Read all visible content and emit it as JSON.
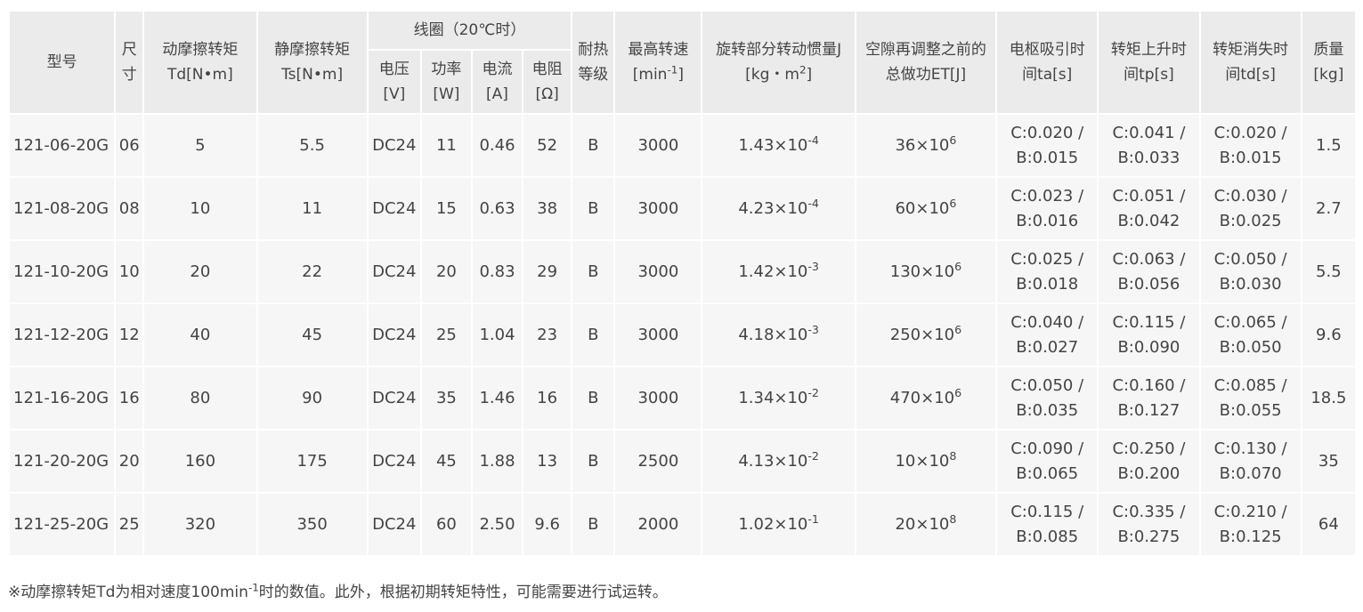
{
  "table": {
    "headers": {
      "model": "型号",
      "size": "尺寸",
      "td": "动摩擦转矩Td[N•m]",
      "ts": "静摩擦转矩Ts[N•m]",
      "coil": "线圈（20℃时）",
      "voltage": "电压[V]",
      "power": "功率[W]",
      "current": "电流[A]",
      "resistance": "电阻[Ω]",
      "heat_class": "耐热等级",
      "max_speed": "最高转速[min-1]",
      "inertia": "旋转部分转动惯量J[kg・m2]",
      "work": "空隙再调整之前的总做功ET[J]",
      "ta": "电枢吸引时间ta[s]",
      "tp": "转矩上升时间tp[s]",
      "tdis": "转矩消失时间td[s]",
      "mass": "质量[kg]"
    },
    "rows": [
      {
        "model": "121-06-20G",
        "size": "06",
        "td": "5",
        "ts": "5.5",
        "voltage": "DC24",
        "power": "11",
        "current": "0.46",
        "resistance": "52",
        "heat": "B",
        "speed": "3000",
        "inertia_m": "1.43×10",
        "inertia_e": "-4",
        "work_m": "36×10",
        "work_e": "6",
        "ta_c": "C:0.020 /",
        "ta_b": "B:0.015",
        "tp_c": "C:0.041 /",
        "tp_b": "B:0.033",
        "td_c": "C:0.020 /",
        "td_b": "B:0.015",
        "mass": "1.5"
      },
      {
        "model": "121-08-20G",
        "size": "08",
        "td": "10",
        "ts": "11",
        "voltage": "DC24",
        "power": "15",
        "current": "0.63",
        "resistance": "38",
        "heat": "B",
        "speed": "3000",
        "inertia_m": "4.23×10",
        "inertia_e": "-4",
        "work_m": "60×10",
        "work_e": "6",
        "ta_c": "C:0.023 /",
        "ta_b": "B:0.016",
        "tp_c": "C:0.051 /",
        "tp_b": "B:0.042",
        "td_c": "C:0.030 /",
        "td_b": "B:0.025",
        "mass": "2.7"
      },
      {
        "model": "121-10-20G",
        "size": "10",
        "td": "20",
        "ts": "22",
        "voltage": "DC24",
        "power": "20",
        "current": "0.83",
        "resistance": "29",
        "heat": "B",
        "speed": "3000",
        "inertia_m": "1.42×10",
        "inertia_e": "-3",
        "work_m": "130×10",
        "work_e": "6",
        "ta_c": "C:0.025 /",
        "ta_b": "B:0.018",
        "tp_c": "C:0.063 /",
        "tp_b": "B:0.056",
        "td_c": "C:0.050 /",
        "td_b": "B:0.030",
        "mass": "5.5"
      },
      {
        "model": "121-12-20G",
        "size": "12",
        "td": "40",
        "ts": "45",
        "voltage": "DC24",
        "power": "25",
        "current": "1.04",
        "resistance": "23",
        "heat": "B",
        "speed": "3000",
        "inertia_m": "4.18×10",
        "inertia_e": "-3",
        "work_m": "250×10",
        "work_e": "6",
        "ta_c": "C:0.040 /",
        "ta_b": "B:0.027",
        "tp_c": "C:0.115 /",
        "tp_b": "B:0.090",
        "td_c": "C:0.065 /",
        "td_b": "B:0.050",
        "mass": "9.6"
      },
      {
        "model": "121-16-20G",
        "size": "16",
        "td": "80",
        "ts": "90",
        "voltage": "DC24",
        "power": "35",
        "current": "1.46",
        "resistance": "16",
        "heat": "B",
        "speed": "3000",
        "inertia_m": "1.34×10",
        "inertia_e": "-2",
        "work_m": "470×10",
        "work_e": "6",
        "ta_c": "C:0.050 /",
        "ta_b": "B:0.035",
        "tp_c": "C:0.160 /",
        "tp_b": "B:0.127",
        "td_c": "C:0.085 /",
        "td_b": "B:0.055",
        "mass": "18.5"
      },
      {
        "model": "121-20-20G",
        "size": "20",
        "td": "160",
        "ts": "175",
        "voltage": "DC24",
        "power": "45",
        "current": "1.88",
        "resistance": "13",
        "heat": "B",
        "speed": "2500",
        "inertia_m": "4.13×10",
        "inertia_e": "-2",
        "work_m": "10×10",
        "work_e": "8",
        "ta_c": "C:0.090 /",
        "ta_b": "B:0.065",
        "tp_c": "C:0.250 /",
        "tp_b": "B:0.200",
        "td_c": "C:0.130 /",
        "td_b": "B:0.070",
        "mass": "35"
      },
      {
        "model": "121-25-20G",
        "size": "25",
        "td": "320",
        "ts": "350",
        "voltage": "DC24",
        "power": "60",
        "current": "2.50",
        "resistance": "9.6",
        "heat": "B",
        "speed": "2000",
        "inertia_m": "1.02×10",
        "inertia_e": "-1",
        "work_m": "20×10",
        "work_e": "8",
        "ta_c": "C:0.115 /",
        "ta_b": "B:0.085",
        "tp_c": "C:0.335 /",
        "tp_b": "B:0.275",
        "td_c": "C:0.210 /",
        "td_b": "B:0.125",
        "mass": "64"
      }
    ]
  },
  "note": {
    "text_before": "※动摩擦转矩Td为相对速度100min",
    "sup": "-1",
    "text_after": "时的数值。此外，根据初期转矩特性，可能需要进行试运转。"
  }
}
